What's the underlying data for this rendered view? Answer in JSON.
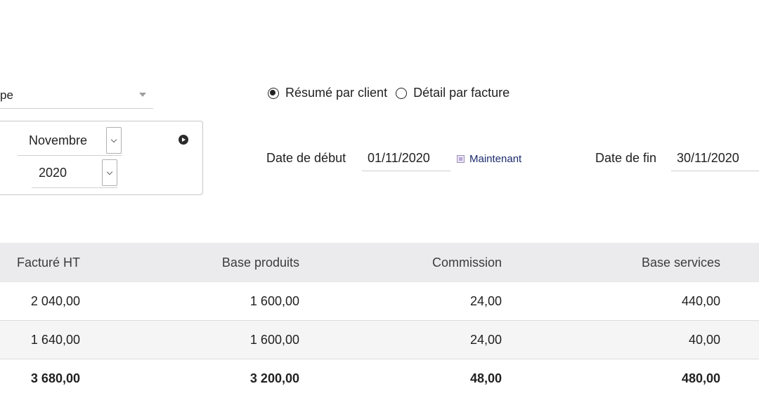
{
  "group_select": {
    "value": "pe"
  },
  "report_mode": {
    "options": [
      {
        "label": "Résumé par client",
        "checked": true
      },
      {
        "label": "Détail par facture",
        "checked": false
      }
    ]
  },
  "period": {
    "month": "Novembre",
    "year": "2020"
  },
  "dates": {
    "start_label": "Date de début",
    "start_value": "01/11/2020",
    "now_label": "Maintenant",
    "end_label": "Date de fin",
    "end_value": "30/11/2020"
  },
  "table": {
    "headers": [
      "Facturé HT",
      "Base produits",
      "Commission",
      "Base services"
    ],
    "rows": [
      [
        "2 040,00",
        "1 600,00",
        "24,00",
        "440,00"
      ],
      [
        "1 640,00",
        "1 600,00",
        "24,00",
        "40,00"
      ]
    ],
    "totals": [
      "3 680,00",
      "3 200,00",
      "48,00",
      "480,00"
    ]
  }
}
